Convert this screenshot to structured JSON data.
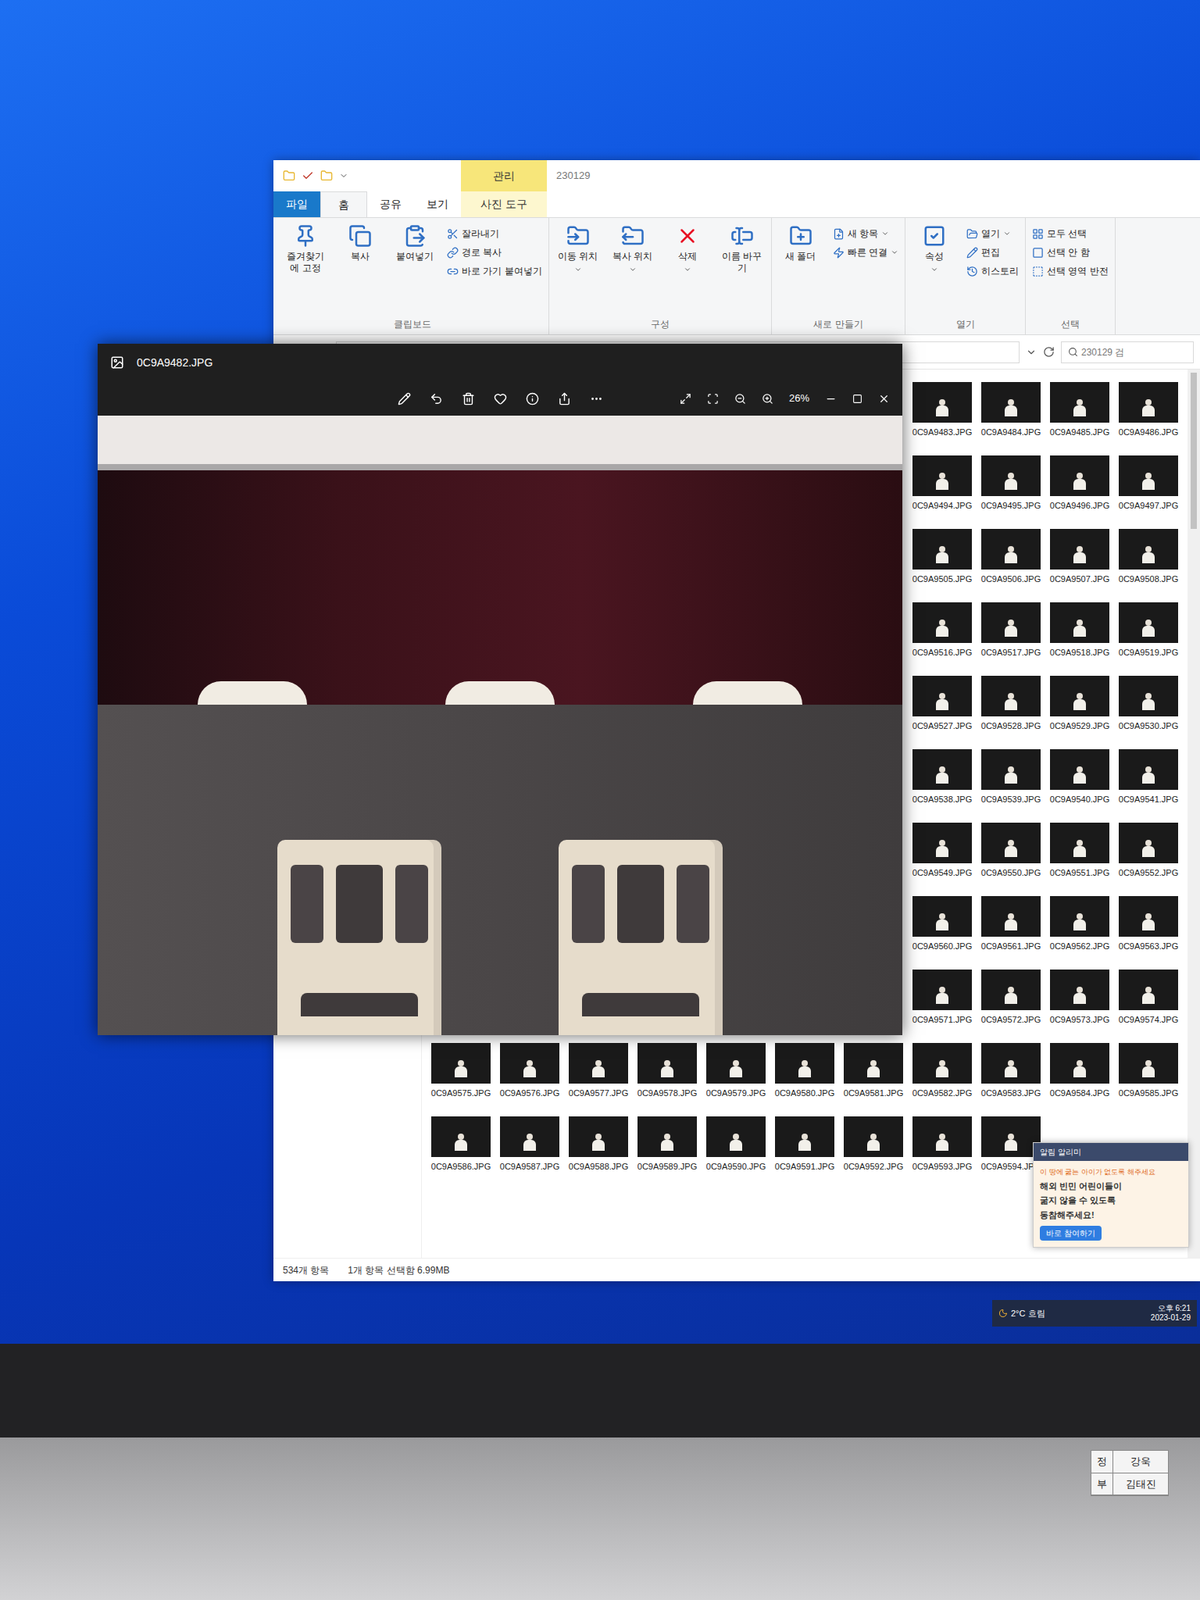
{
  "explorer": {
    "title": "230129",
    "context_header": "관리",
    "tabs": [
      {
        "label": "파일",
        "selected": false,
        "kind": "file"
      },
      {
        "label": "홈",
        "selected": true,
        "kind": "normal"
      },
      {
        "label": "공유",
        "selected": false,
        "kind": "normal"
      },
      {
        "label": "보기",
        "selected": false,
        "kind": "normal"
      },
      {
        "label": "사진 도구",
        "selected": false,
        "kind": "context"
      }
    ],
    "ribbon_groups": [
      {
        "label": "클립보드",
        "items": [
          {
            "label": "즐겨찾기에 고정",
            "kind": "large",
            "dropdown": false
          },
          {
            "label": "복사",
            "kind": "large",
            "dropdown": false
          },
          {
            "label": "붙여넣기",
            "kind": "large",
            "dropdown": false
          },
          {
            "label": "잘라내기",
            "kind": "small",
            "dropdown": false
          },
          {
            "label": "경로 복사",
            "kind": "small",
            "dropdown": false
          },
          {
            "label": "바로 가기 붙여넣기",
            "kind": "small",
            "dropdown": false
          }
        ]
      },
      {
        "label": "구성",
        "items": [
          {
            "label": "이동 위치",
            "kind": "large",
            "dropdown": true
          },
          {
            "label": "복사 위치",
            "kind": "large",
            "dropdown": true
          },
          {
            "label": "삭제",
            "kind": "large",
            "dropdown": true
          },
          {
            "label": "이름 바꾸기",
            "kind": "large",
            "dropdown": false
          }
        ]
      },
      {
        "label": "새로 만들기",
        "items": [
          {
            "label": "새 폴더",
            "kind": "large",
            "dropdown": false
          },
          {
            "label": "새 항목",
            "kind": "small",
            "dropdown": true
          },
          {
            "label": "빠른 연결",
            "kind": "small",
            "dropdown": true
          }
        ]
      },
      {
        "label": "열기",
        "items": [
          {
            "label": "속성",
            "kind": "large",
            "dropdown": true
          },
          {
            "label": "열기",
            "kind": "small",
            "dropdown": true
          },
          {
            "label": "편집",
            "kind": "small",
            "dropdown": false
          },
          {
            "label": "히스토리",
            "kind": "small",
            "dropdown": false
          }
        ]
      },
      {
        "label": "선택",
        "items": [
          {
            "label": "모두 선택",
            "kind": "small",
            "dropdown": false
          },
          {
            "label": "선택 안 함",
            "kind": "small",
            "dropdown": false
          },
          {
            "label": "선택 영역 반전",
            "kind": "small",
            "dropdown": false
          }
        ]
      }
    ],
    "search": {
      "placeholder": "230129 검"
    },
    "upper_rows": [
      [
        "0C9A9483.JPG",
        "0C9A9484.JPG",
        "0C9A9485.JPG",
        "0C9A9486.JPG"
      ],
      [
        "0C9A9494.JPG",
        "0C9A9495.JPG",
        "0C9A9496.JPG",
        "0C9A9497.JPG"
      ],
      [
        "0C9A9505.JPG",
        "0C9A9506.JPG",
        "0C9A9507.JPG",
        "0C9A9508.JPG"
      ],
      [
        "0C9A9516.JPG",
        "0C9A9517.JPG",
        "0C9A9518.JPG",
        "0C9A9519.JPG"
      ],
      [
        "0C9A9527.JPG",
        "0C9A9528.JPG",
        "0C9A9529.JPG",
        "0C9A9530.JPG"
      ],
      [
        "0C9A9538.JPG",
        "0C9A9539.JPG",
        "0C9A9540.JPG",
        "0C9A9541.JPG"
      ],
      [
        "0C9A9549.JPG",
        "0C9A9550.JPG",
        "0C9A9551.JPG",
        "0C9A9552.JPG"
      ],
      [
        "0C9A9560.JPG",
        "0C9A9561.JPG",
        "0C9A9562.JPG",
        "0C9A9563.JPG"
      ],
      [
        "0C9A9571.JPG",
        "0C9A9572.JPG",
        "0C9A9573.JPG",
        "0C9A9574.JPG"
      ]
    ],
    "lower_rows": [
      [
        "0C9A9575.JPG",
        "0C9A9576.JPG",
        "0C9A9577.JPG",
        "0C9A9578.JPG",
        "0C9A9579.JPG",
        "0C9A9580.JPG",
        "0C9A9581.JPG",
        "0C9A9582.JPG",
        "0C9A9583.JPG",
        "0C9A9584.JPG",
        "0C9A9585.JPG"
      ],
      [
        "0C9A9586.JPG",
        "0C9A9587.JPG",
        "0C9A9588.JPG",
        "0C9A9589.JPG",
        "0C9A9590.JPG",
        "0C9A9591.JPG",
        "0C9A9592.JPG",
        "0C9A9593.JPG",
        "0C9A9594.JPG"
      ]
    ],
    "status_bar": {
      "count": "534개 항목",
      "selection": "1개 항목 선택함 6.99MB"
    }
  },
  "photos": {
    "title": "0C9A9482.JPG",
    "zoom": "26%"
  },
  "notification": {
    "header": "알림 알리미",
    "lines": [
      "이 땅에 굶는 아이가 없도록 해주세요",
      "해외 빈민 어린이들이",
      "굶지 않을 수 있도록",
      "동참해주세요!"
    ],
    "button": "바로 참여하기"
  },
  "tray": {
    "weather": "2°C 흐림",
    "time": "오후 6:21",
    "date": "2023-01-29"
  },
  "sticker": [
    {
      "role": "정",
      "name": "강욱"
    },
    {
      "role": "부",
      "name": "김태진"
    }
  ]
}
